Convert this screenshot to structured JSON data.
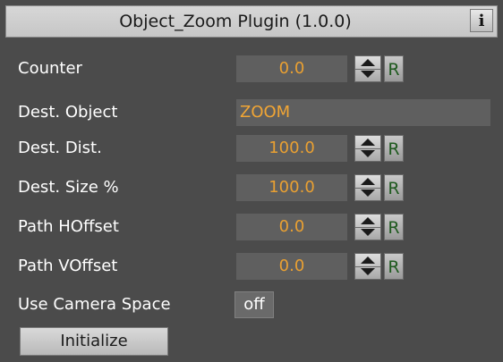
{
  "window": {
    "title": "Object_Zoom Plugin (1.0.0)",
    "info_label": "i"
  },
  "fields": [
    {
      "label": "Counter",
      "value": "0.0",
      "reset_label": "R"
    },
    {
      "label": "Dest. Object",
      "value": "ZOOM"
    },
    {
      "label": "Dest. Dist.",
      "value": "100.0",
      "reset_label": "R"
    },
    {
      "label": "Dest. Size %",
      "value": "100.0",
      "reset_label": "R"
    },
    {
      "label": "Path HOffset",
      "value": "0.0",
      "reset_label": "R"
    },
    {
      "label": "Path VOffset",
      "value": "0.0",
      "reset_label": "R"
    }
  ],
  "camera_space": {
    "label": "Use Camera Space",
    "value": "off"
  },
  "actions": {
    "initialize_label": "Initialize"
  },
  "colors": {
    "panel_bg": "#4b4b4b",
    "value_text": "#e9a032",
    "reset_text": "#1f5a1f"
  },
  "icons": {
    "info": "info-icon",
    "stepper_up": "arrow-up-icon",
    "stepper_down": "arrow-down-icon"
  }
}
